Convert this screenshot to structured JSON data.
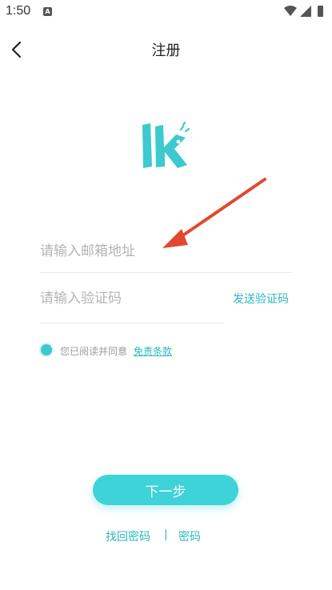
{
  "status_bar": {
    "time": "1:50",
    "notification_badge": "A",
    "icons": [
      "wifi-icon",
      "signal-icon",
      "battery-icon"
    ]
  },
  "header": {
    "title": "注册",
    "back_icon": "chevron-left-icon"
  },
  "form": {
    "email_placeholder": "请输入邮箱地址",
    "email_value": "",
    "code_placeholder": "请输入验证码",
    "code_value": "",
    "send_code_label": "发送验证码"
  },
  "agreement": {
    "checked": true,
    "text": "您已阅读并同意",
    "terms_link": "免责条款"
  },
  "actions": {
    "next_label": "下一步",
    "find_password_label": "找回密码",
    "separator": "|",
    "password_login_label": "密码"
  },
  "colors": {
    "accent": "#3dd3d8",
    "link": "#2bb8bd",
    "annotation_arrow": "#e0492f"
  }
}
